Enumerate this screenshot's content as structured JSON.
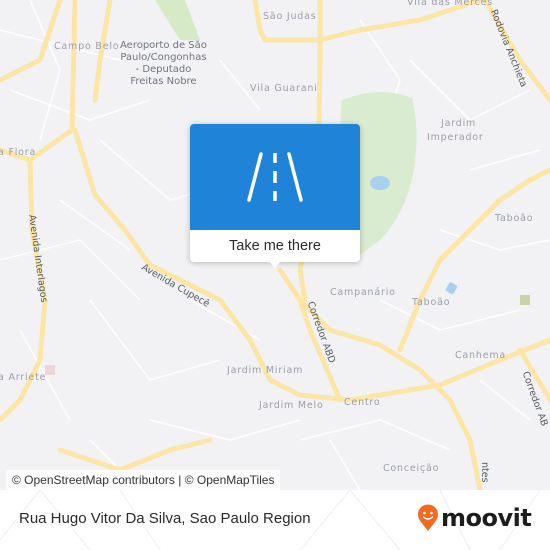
{
  "map": {
    "place_labels": [
      {
        "id": "campo-belo",
        "text": "Campo Belo"
      },
      {
        "id": "sao-judas",
        "text": "São Judas"
      },
      {
        "id": "vila-das-merces",
        "text": "Vila das Mercês"
      },
      {
        "id": "vila-guarani",
        "text": "Vila Guarani"
      },
      {
        "id": "jardim-imperador-1",
        "text": "Jardim"
      },
      {
        "id": "jardim-imperador-2",
        "text": "Imperador"
      },
      {
        "id": "vila-flora",
        "text": "a Flora"
      },
      {
        "id": "taboao-1",
        "text": "Taboão"
      },
      {
        "id": "campanario",
        "text": "Campanário"
      },
      {
        "id": "taboao-2",
        "text": "Taboão"
      },
      {
        "id": "canhema",
        "text": "Canhema"
      },
      {
        "id": "jardim-miriam",
        "text": "Jardim Miriam"
      },
      {
        "id": "vila-arriete",
        "text": "a Arriete"
      },
      {
        "id": "jardim-melo",
        "text": "Jardim Melo"
      },
      {
        "id": "centro",
        "text": "Centro"
      },
      {
        "id": "conceicao",
        "text": "Conceição"
      }
    ],
    "poi_label": {
      "lines": [
        "Aeroporto de São",
        "Paulo/Congonhas",
        "- Deputado",
        "Freitas Nobre"
      ]
    },
    "road_labels": [
      {
        "id": "rodovia-anchieta",
        "text": "Rodovia Anchieta"
      },
      {
        "id": "avenida-interlagos",
        "text": "Avenida Interlagos"
      },
      {
        "id": "avenida-cupece",
        "text": "Avenida Cupecê"
      },
      {
        "id": "corredor-abd-1",
        "text": "Corredor ABD"
      },
      {
        "id": "corredor-abd-2",
        "text": "Corredor AB"
      },
      {
        "id": "road-partial-bottom",
        "text": "ntes"
      }
    ],
    "colors": {
      "background": "#f2f2f4",
      "major_road": "#fbe6a6",
      "minor_road": "#ffffff",
      "park": "#d9ecd0",
      "water": "#a8d0f0"
    }
  },
  "popup": {
    "icon": "road-icon",
    "cta_label": "Take me there",
    "accent_color": "#1f83d8"
  },
  "attribution": {
    "osm": "© OpenStreetMap contributors",
    "separator": " | ",
    "omt": "© OpenMapTiles"
  },
  "footer": {
    "address": "Rua Hugo Vitor Da Silva, Sao Paulo Region",
    "brand": "moovit",
    "brand_color": "#f26b21"
  }
}
